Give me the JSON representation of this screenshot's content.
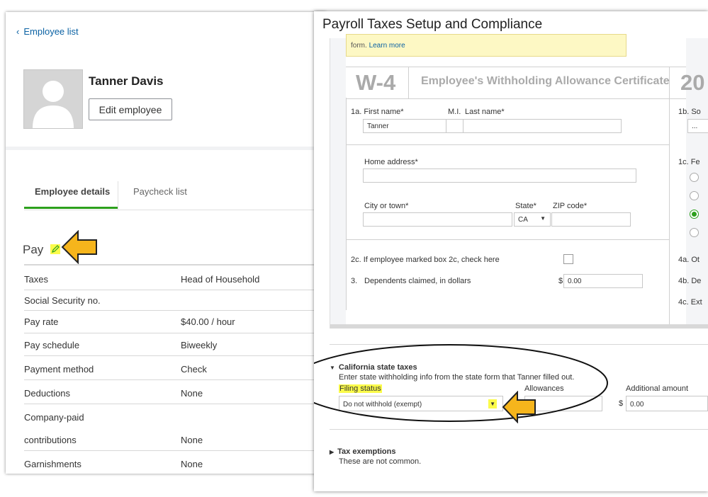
{
  "left": {
    "back_link": "Employee list",
    "employee_name": "Tanner Davis",
    "edit_button": "Edit employee",
    "tabs": [
      "Employee details",
      "Paycheck list"
    ],
    "section_title": "Pay",
    "rows": [
      {
        "label": "Taxes",
        "value": "Head of Household"
      },
      {
        "label": "Social Security no.",
        "value": ""
      },
      {
        "label": "Pay rate",
        "value": "$40.00 / hour"
      },
      {
        "label": "Pay schedule",
        "value": "Biweekly"
      },
      {
        "label": "Payment method",
        "value": "Check"
      },
      {
        "label": "Deductions",
        "value": "None"
      },
      {
        "label": "Company-paid",
        "value": ""
      },
      {
        "label": "contributions",
        "value": "None"
      },
      {
        "label": "Garnishments",
        "value": "None"
      }
    ]
  },
  "right": {
    "title": "Payroll Taxes Setup and Compliance",
    "notice_text": "form.",
    "notice_link": "Learn more",
    "w4_label": "W-4",
    "w4_title": "Employee's Withholding Allowance Certificate",
    "w4_year": "20",
    "first_name_label": "1a. First name*",
    "mi_label": "M.I.",
    "last_name_label": "Last name*",
    "first_name_value": "Tanner",
    "ssn_label": "1b. So",
    "ssn_value": "...",
    "home_address_label": "Home address*",
    "fed_label": "1c. Fe",
    "city_label": "City or town*",
    "state_label": "State*",
    "state_value": "CA",
    "zip_label": "ZIP code*",
    "box2c_label": "2c. If employee marked box 2c, check here",
    "dependents_num": "3.",
    "dependents_label": "Dependents claimed, in dollars",
    "dependents_currency": "$",
    "dependents_value": "0.00",
    "side_4a": "4a. Ot",
    "side_4b": "4b. De",
    "side_4c": "4c. Ext",
    "state_section_title": "California state taxes",
    "state_section_desc": "Enter state withholding info from the state form that Tanner filled out.",
    "filing_status_label": "Filing status",
    "allowances_label": "Allowances",
    "additional_label": "Additional amount",
    "filing_status_value": "Do not withhold (exempt)",
    "additional_currency": "$",
    "additional_value": "0.00",
    "exemptions_title": "Tax exemptions",
    "exemptions_desc": "These are not common."
  },
  "colors": {
    "accent_green": "#2ca01c",
    "link_blue": "#0b62a4",
    "highlight": "#fbfb4a",
    "arrow": "#f6b51c"
  }
}
